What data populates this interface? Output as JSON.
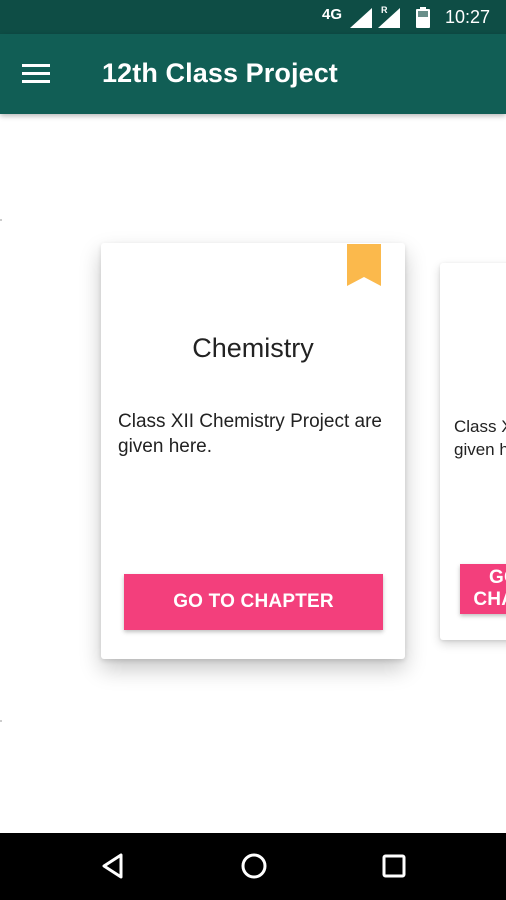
{
  "status_bar": {
    "network": "4G",
    "roaming": "R",
    "time": "10:27",
    "icons": [
      "signal-icon",
      "signal-roaming-icon",
      "battery-icon"
    ]
  },
  "app_bar": {
    "title": "12th Class Project",
    "menu_icon": "hamburger-menu-icon"
  },
  "cards": [
    {
      "title": "Chemistry",
      "description": "Class XII Chemistry Project are given here.",
      "button_label": "GO TO CHAPTER",
      "bookmark_icon": "bookmark-icon"
    },
    {
      "title": "",
      "description": "Class XII Physics Project are given here.",
      "button_label": "GO TO CHAPTER"
    }
  ],
  "nav_bar": {
    "back_icon": "back-triangle-icon",
    "home_icon": "home-circle-icon",
    "recent_icon": "recent-apps-square-icon"
  },
  "colors": {
    "status_bar": "#0e4d45",
    "app_bar": "#115e55",
    "accent_button": "#f33f7c",
    "bookmark": "#fbb94c",
    "nav_bar": "#000000"
  }
}
